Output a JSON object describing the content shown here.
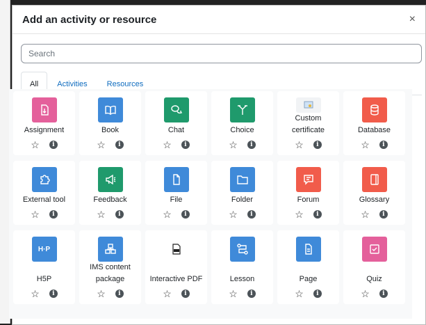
{
  "modal": {
    "title": "Add an activity or resource",
    "close_symbol": "×"
  },
  "search": {
    "placeholder": "Search"
  },
  "tabs": [
    {
      "label": "All"
    },
    {
      "label": "Activities"
    },
    {
      "label": "Resources"
    }
  ],
  "colors": {
    "pink": "#e4609b",
    "blue": "#3f8ad9",
    "green": "#1f9a6c",
    "red": "#f15c4b",
    "light": "#f1f3f5"
  },
  "tiles": [
    {
      "label": "Assignment",
      "icon": "assignment-icon",
      "color": "#e4609b"
    },
    {
      "label": "Book",
      "icon": "book-icon",
      "color": "#3f8ad9"
    },
    {
      "label": "Chat",
      "icon": "chat-icon",
      "color": "#1f9a6c"
    },
    {
      "label": "Choice",
      "icon": "choice-icon",
      "color": "#1f9a6c"
    },
    {
      "label": "Custom certificate",
      "icon": "certificate-icon",
      "color": "#f1f3f5"
    },
    {
      "label": "Database",
      "icon": "database-icon",
      "color": "#f15c4b"
    },
    {
      "label": "External tool",
      "icon": "puzzle-icon",
      "color": "#3f8ad9"
    },
    {
      "label": "Feedback",
      "icon": "megaphone-icon",
      "color": "#1f9a6c"
    },
    {
      "label": "File",
      "icon": "file-icon",
      "color": "#3f8ad9"
    },
    {
      "label": "Folder",
      "icon": "folder-icon",
      "color": "#3f8ad9"
    },
    {
      "label": "Forum",
      "icon": "forum-icon",
      "color": "#f15c4b"
    },
    {
      "label": "Glossary",
      "icon": "glossary-icon",
      "color": "#f15c4b"
    },
    {
      "label": "H5P",
      "icon": "h5p-icon",
      "icon_text": "H·P",
      "color": "#3f8ad9"
    },
    {
      "label": "IMS content package",
      "icon": "package-icon",
      "color": "#3f8ad9"
    },
    {
      "label": "Interactive PDF",
      "icon": "pdf-icon",
      "icon_text": "PDF",
      "color": "#ffffff"
    },
    {
      "label": "Lesson",
      "icon": "lesson-icon",
      "color": "#3f8ad9"
    },
    {
      "label": "Page",
      "icon": "page-icon",
      "color": "#3f8ad9"
    },
    {
      "label": "Quiz",
      "icon": "quiz-icon",
      "color": "#e4609b"
    }
  ],
  "tile_actions": {
    "star_symbol": "☆",
    "info_symbol": "i"
  }
}
